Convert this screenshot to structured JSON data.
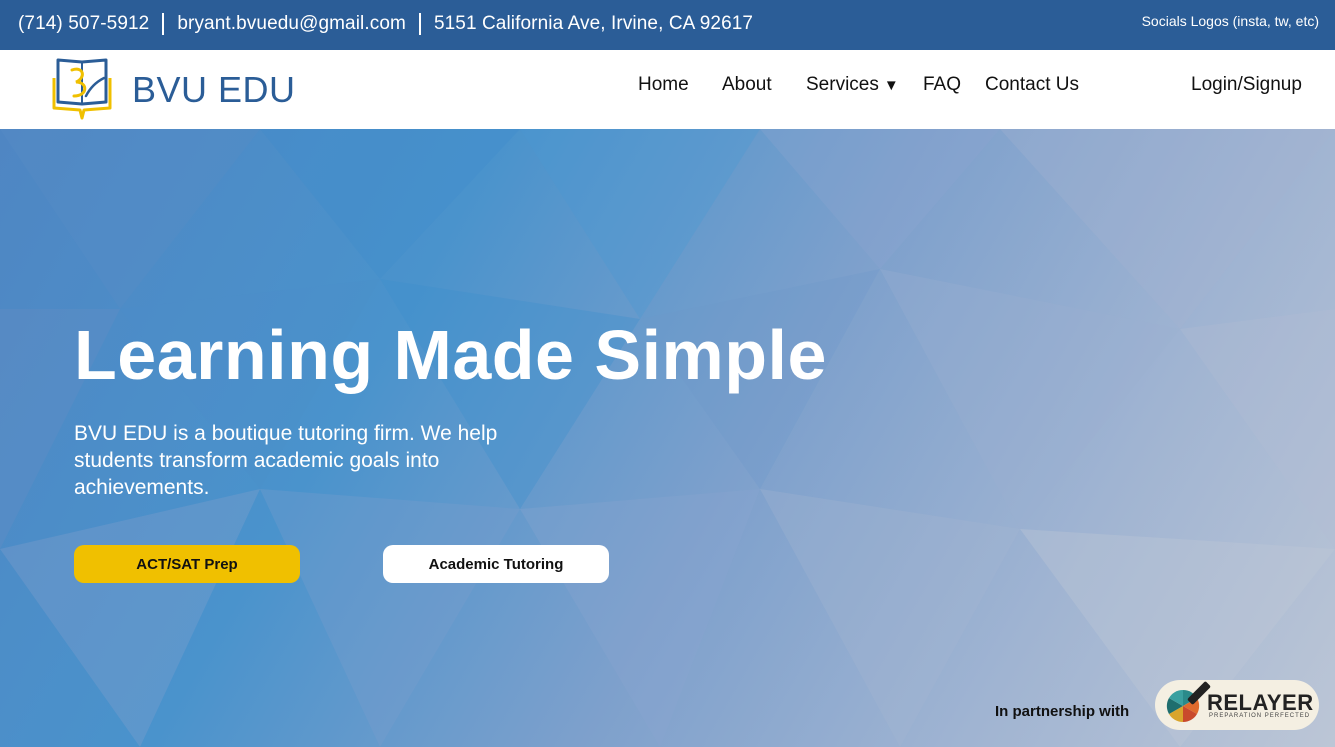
{
  "topbar": {
    "phone": "(714) 507-5912",
    "email": "bryant.bvuedu@gmail.com",
    "address": "5151 California Ave, Irvine, CA 92617",
    "socials": "Socials Logos (insta, tw, etc)"
  },
  "brand": {
    "name": "BVU EDU",
    "logo_icon": "book-icon",
    "colors": {
      "primary": "#2b5d97",
      "accent": "#f0c000"
    }
  },
  "nav": {
    "home": "Home",
    "about": "About",
    "services": "Services",
    "services_caret": "▼",
    "faq": "FAQ",
    "contact": "Contact Us",
    "login": "Login/Signup"
  },
  "hero": {
    "headline": "Learning Made Simple",
    "subtext": "BVU EDU is a boutique tutoring firm. We help students transform academic goals into achievements.",
    "cta_primary": "ACT/SAT Prep",
    "cta_secondary": "Academic Tutoring"
  },
  "partner": {
    "label": "In partnership with",
    "name": "RELAYER",
    "tagline": "PREPARATION PERFECTED",
    "logo_icon": "relayer-logo-icon"
  }
}
